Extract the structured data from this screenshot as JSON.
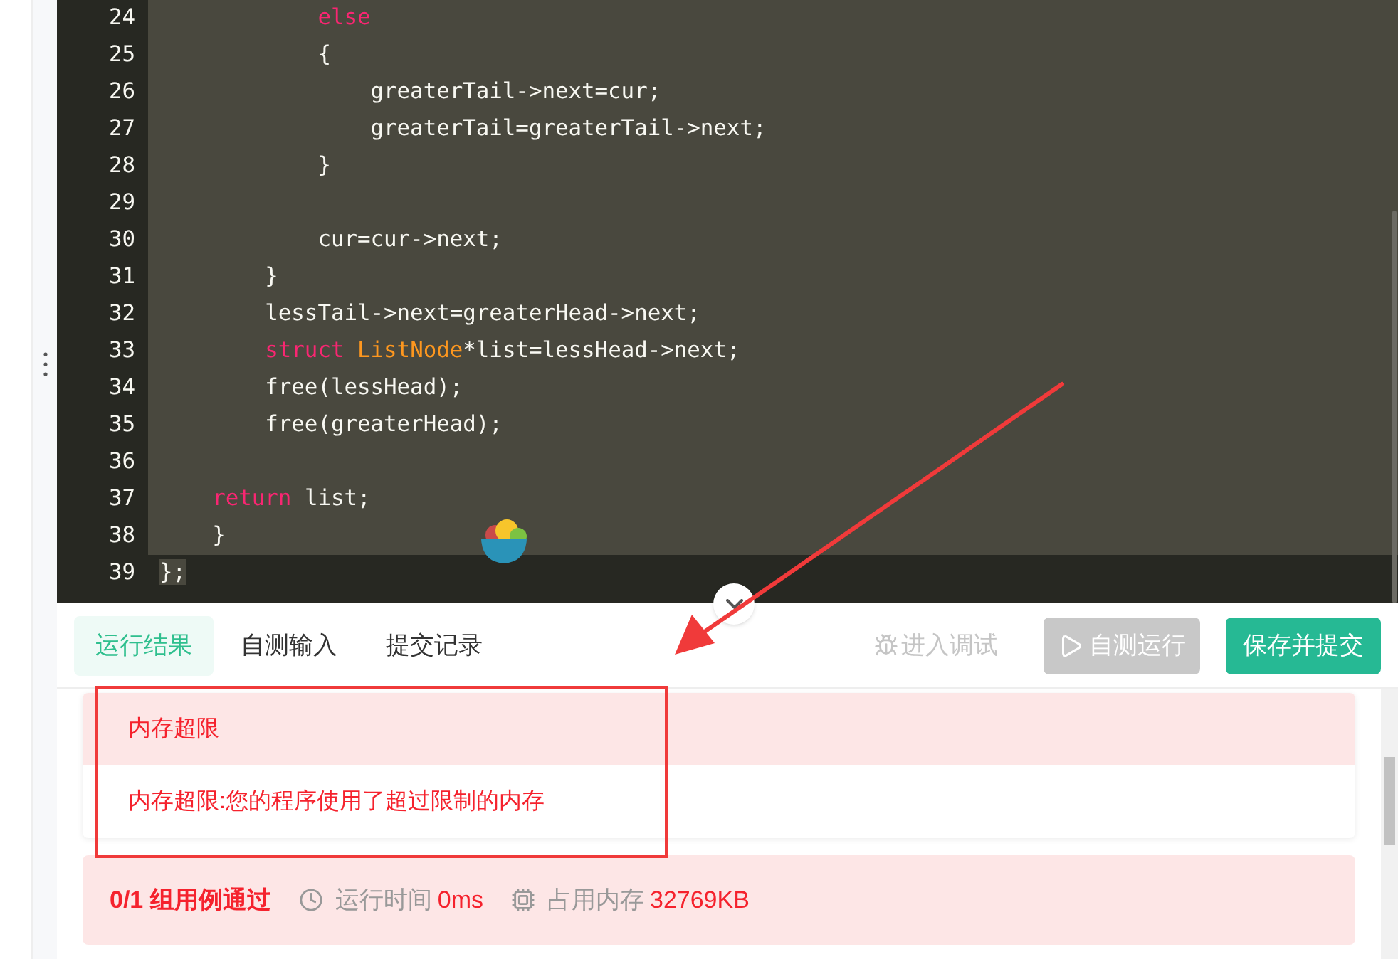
{
  "editor": {
    "lines": [
      {
        "number": "24",
        "selected": true,
        "tokens": [
          {
            "kind": "keyword",
            "text": "            else"
          }
        ]
      },
      {
        "number": "25",
        "selected": true,
        "tokens": [
          {
            "kind": "plain",
            "text": "            {"
          }
        ]
      },
      {
        "number": "26",
        "selected": true,
        "tokens": [
          {
            "kind": "plain",
            "text": "                greaterTail->next=cur;"
          }
        ]
      },
      {
        "number": "27",
        "selected": true,
        "tokens": [
          {
            "kind": "plain",
            "text": "                greaterTail=greaterTail->next;"
          }
        ]
      },
      {
        "number": "28",
        "selected": true,
        "tokens": [
          {
            "kind": "plain",
            "text": "            }"
          }
        ]
      },
      {
        "number": "29",
        "selected": true
      },
      {
        "number": "30",
        "selected": true,
        "tokens": [
          {
            "kind": "plain",
            "text": "            cur=cur->next;"
          }
        ]
      },
      {
        "number": "31",
        "selected": true,
        "tokens": [
          {
            "kind": "plain",
            "text": "        }"
          }
        ]
      },
      {
        "number": "32",
        "selected": true,
        "tokens": [
          {
            "kind": "plain",
            "text": "        lessTail->next=greaterHead->next;"
          }
        ]
      },
      {
        "number": "33",
        "selected": true,
        "tokens": [
          {
            "kind": "keyword",
            "text": "        struct"
          },
          {
            "kind": "type",
            "text": " ListNode"
          },
          {
            "kind": "plain",
            "text": "*list=lessHead->next;"
          }
        ]
      },
      {
        "number": "34",
        "selected": true,
        "tokens": [
          {
            "kind": "plain",
            "text": "        free(lessHead);"
          }
        ]
      },
      {
        "number": "35",
        "selected": true,
        "tokens": [
          {
            "kind": "plain",
            "text": "        free(greaterHead);"
          }
        ]
      },
      {
        "number": "36",
        "selected": true
      },
      {
        "number": "37",
        "selected": true,
        "tokens": [
          {
            "kind": "keyword",
            "text": "    return"
          },
          {
            "kind": "plain",
            "text": " list;"
          }
        ]
      },
      {
        "number": "38",
        "selected": true,
        "tokens": [
          {
            "kind": "plain",
            "text": "    }"
          }
        ]
      },
      {
        "number": "39",
        "selected": false,
        "tokens": [
          {
            "kind": "plain",
            "text": "};",
            "selected": true
          }
        ]
      }
    ]
  },
  "tabs": [
    {
      "label": "运行结果",
      "selected": true
    },
    {
      "label": "自测输入",
      "selected": false
    },
    {
      "label": "提交记录",
      "selected": false
    }
  ],
  "actions": [
    {
      "kind": "link",
      "label": "进入调试",
      "disabled": true
    },
    {
      "kind": "button",
      "label": "自测运行",
      "disabled": true
    },
    {
      "kind": "primary",
      "label": "保存并提交",
      "disabled": false
    }
  ],
  "result": {
    "title": "内存超限",
    "message": "内存超限:您的程序使用了超过限制的内存"
  },
  "summary": {
    "passed": "0/1 组用例通过",
    "time_label": "运行时间",
    "time_value": "0ms",
    "memory_label": "占用内存",
    "memory_value": "32769KB"
  }
}
